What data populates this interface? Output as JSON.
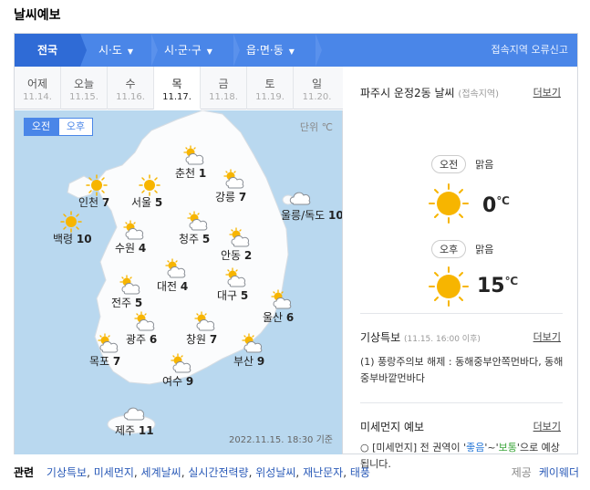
{
  "page_title": "날씨예보",
  "breadcrumbs": [
    {
      "label": "전국",
      "caret": false
    },
    {
      "label": "시·도",
      "caret": true
    },
    {
      "label": "시·군·구",
      "caret": true
    },
    {
      "label": "읍·면·동",
      "caret": true
    }
  ],
  "report_link": "접속지역 오류신고",
  "days": [
    {
      "name": "어제",
      "date": "11.14."
    },
    {
      "name": "오늘",
      "date": "11.15."
    },
    {
      "name": "수",
      "date": "11.16."
    },
    {
      "name": "목",
      "date": "11.17."
    },
    {
      "name": "금",
      "date": "11.18."
    },
    {
      "name": "토",
      "date": "11.19."
    },
    {
      "name": "일",
      "date": "11.20."
    }
  ],
  "selected_day": 3,
  "map": {
    "am_label": "오전",
    "pm_label": "오후",
    "unit": "단위 ℃",
    "timestamp": "2022.11.15. 18:30 기준",
    "cities": [
      {
        "name": "춘천",
        "temp": "1",
        "icon": "partly-cloudy-icon"
      },
      {
        "name": "인천",
        "temp": "7",
        "icon": "sun-icon"
      },
      {
        "name": "서울",
        "temp": "5",
        "icon": "sun-icon"
      },
      {
        "name": "강릉",
        "temp": "7",
        "icon": "partly-cloudy-icon"
      },
      {
        "name": "울릉/독도",
        "temp": "10",
        "icon": "cloud-icon"
      },
      {
        "name": "백령",
        "temp": "10",
        "icon": "sun-icon"
      },
      {
        "name": "수원",
        "temp": "4",
        "icon": "partly-cloudy-icon"
      },
      {
        "name": "청주",
        "temp": "5",
        "icon": "partly-cloudy-icon"
      },
      {
        "name": "안동",
        "temp": "2",
        "icon": "partly-cloudy-icon"
      },
      {
        "name": "대전",
        "temp": "4",
        "icon": "partly-cloudy-icon"
      },
      {
        "name": "대구",
        "temp": "5",
        "icon": "partly-cloudy-icon"
      },
      {
        "name": "전주",
        "temp": "5",
        "icon": "partly-cloudy-icon"
      },
      {
        "name": "울산",
        "temp": "6",
        "icon": "partly-cloudy-icon"
      },
      {
        "name": "광주",
        "temp": "6",
        "icon": "partly-cloudy-icon"
      },
      {
        "name": "창원",
        "temp": "7",
        "icon": "partly-cloudy-icon"
      },
      {
        "name": "목포",
        "temp": "7",
        "icon": "partly-cloudy-icon"
      },
      {
        "name": "부산",
        "temp": "9",
        "icon": "partly-cloudy-icon"
      },
      {
        "name": "여수",
        "temp": "9",
        "icon": "partly-cloudy-icon"
      },
      {
        "name": "제주",
        "temp": "11",
        "icon": "cloud-icon"
      }
    ]
  },
  "local": {
    "title": "파주시 운정2동 날씨",
    "subtitle": "(접속지역)",
    "more": "더보기",
    "am": {
      "label": "오전",
      "condition": "맑음",
      "temp": "0",
      "unit": "℃"
    },
    "pm": {
      "label": "오후",
      "condition": "맑음",
      "temp": "15",
      "unit": "℃"
    }
  },
  "alert": {
    "title": "기상특보",
    "time": "(11.15. 16:00 이후)",
    "more": "더보기",
    "text": "(1) 풍랑주의보 해제 : 동해중부안쪽먼바다, 동해중부바깥먼바다"
  },
  "dust": {
    "title": "미세먼지 예보",
    "more": "더보기",
    "prefix": "○ [미세먼지] 전 권역이 '",
    "good": "좋음",
    "mid": "'~'",
    "normal": "보통",
    "suffix": "'으로 예상됩니다."
  },
  "related": {
    "label": "관련",
    "links": [
      "기상특보",
      "미세먼지",
      "세계날씨",
      "실시간전력량",
      "위성날씨",
      "재난문자",
      "태풍"
    ]
  },
  "provider": {
    "label": "제공",
    "name": "케이웨더"
  },
  "colors": {
    "accent": "#4a86e8",
    "sun": "#f7b500",
    "good": "#2b7bd8",
    "normal": "#3aa53a"
  }
}
